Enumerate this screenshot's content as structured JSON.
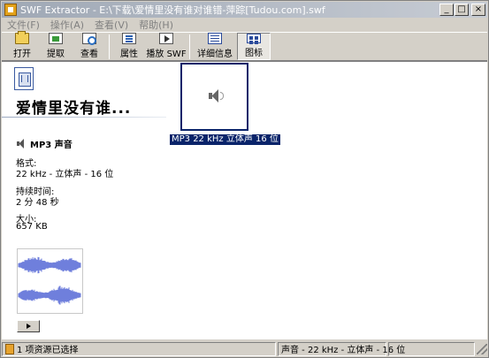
{
  "window": {
    "title": "SWF Extractor - E:\\下载\\爱情里没有谁对谁错-萍踪[Tudou.com].swf",
    "buttons": {
      "minimize": "_",
      "maximize": "□",
      "close": "×"
    }
  },
  "menu": {
    "items": [
      "文件(F)",
      "操作(A)",
      "查看(V)",
      "帮助(H)"
    ]
  },
  "toolbar": {
    "items": [
      {
        "label": "打开",
        "icon": "open-folder-icon"
      },
      {
        "label": "提取",
        "icon": "extract-icon"
      },
      {
        "label": "查看",
        "icon": "view-icon"
      },
      {
        "label": "属性",
        "icon": "properties-icon"
      },
      {
        "label": "播放 SWF",
        "icon": "play-swf-icon"
      },
      {
        "label": "详细信息",
        "icon": "details-icon"
      },
      {
        "label": "图标",
        "icon": "icons-view-icon"
      }
    ]
  },
  "info": {
    "title": "爱情里没有谁...",
    "type": "MP3 声音",
    "format_label": "格式:",
    "format_value": "22 kHz - 立体声 - 16 位",
    "duration_label": "持续时间:",
    "duration_value": "2 分 48 秒",
    "size_label": "大小:",
    "size_value": "657 KB"
  },
  "item": {
    "label": "MP3 22 kHz 立体声 16 位",
    "selected": true
  },
  "status": {
    "left": "1 项资源已选择",
    "right": "声音 - 22 kHz - 立体声 - 16 位"
  },
  "colors": {
    "selection": "#0a246a",
    "waveform": "#6f7fdc",
    "chrome": "#d4d0c8"
  }
}
